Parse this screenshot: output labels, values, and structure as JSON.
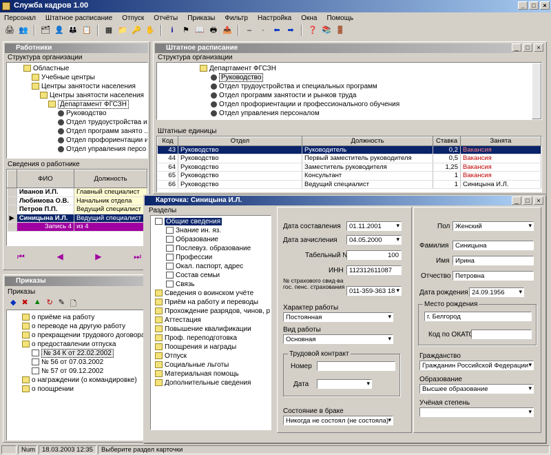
{
  "app": {
    "title": "Служба кадров 1.00"
  },
  "menu": [
    "Персонал",
    "Штатное расписание",
    "Отпуск",
    "Отчёты",
    "Приказы",
    "Фильтр",
    "Настройка",
    "Окна",
    "Помощь"
  ],
  "workers_panel": {
    "title": "Работники",
    "tree_label": "Структура организации",
    "tree": [
      "Областные",
      "Учебные центры",
      "Центры занятости населения",
      "Департамент ФГСЗН",
      "Руководство",
      "Отдел трудоустройства и ...",
      "Отдел программ занято ...",
      "Отдел профориентации и ...",
      "Отдел управления персо ..."
    ],
    "info_label": "Сведения о работнике",
    "columns": [
      "ФИО",
      "Должность"
    ],
    "rows": [
      {
        "fio": "Иванов И.П.",
        "pos": "Главный специалист"
      },
      {
        "fio": "Любимова О.В.",
        "pos": "Начальник отдела"
      },
      {
        "fio": "Петров П.П.",
        "pos": "Ведущий специалист"
      },
      {
        "fio": "Синицына И.Л.",
        "pos": "Ведущий специалист"
      }
    ],
    "record_label": "Запись 4",
    "record_of": "из 4"
  },
  "orders_panel": {
    "title": "Приказы",
    "label": "Приказы",
    "tree": [
      "о приёме на работу",
      "о переводе на другую работу",
      "о прекращении трудового договора",
      "о предоставлении отпуска",
      "№ 34 К от 22.02.2002",
      "№ 56 от 07.03.2002",
      "№ 57 от 09.12.2002",
      "о награждении (о командировке)",
      "о поощрении"
    ]
  },
  "staff_panel": {
    "title": "Штатное расписание",
    "tree_label": "Структура организации",
    "tree": [
      "Департамент ФГСЗН",
      "Руководство",
      "Отдел трудоустройства и специальных программ",
      "Отдел программ занятости и рынков труда",
      "Отдел профориентации и профессионального обучения",
      "Отдел управления персоналом"
    ],
    "units_label": "Штатные единицы",
    "columns": [
      "Код",
      "Отдел",
      "Должность",
      "Ставка",
      "Занята"
    ],
    "rows": [
      {
        "code": "43",
        "dept": "Руководство",
        "pos": "Руководитель",
        "rate": "0,2",
        "busy": "Вакансия"
      },
      {
        "code": "44",
        "dept": "Руководство",
        "pos": "Первый заместитель руководителя",
        "rate": "0,5",
        "busy": "Вакансия"
      },
      {
        "code": "64",
        "dept": "Руководство",
        "pos": "Заместитель руководителя",
        "rate": "1,25",
        "busy": "Вакансия"
      },
      {
        "code": "65",
        "dept": "Руководство",
        "pos": "Консультант",
        "rate": "1",
        "busy": "Вакансия"
      },
      {
        "code": "66",
        "dept": "Руководство",
        "pos": "Ведущий специалист",
        "rate": "1",
        "busy": "Синицына И.Л."
      }
    ]
  },
  "card": {
    "title": "Карточка: Синицына И.Л.",
    "sections_label": "Разделы",
    "sections": [
      "Общие сведения",
      "Знание ин. яз.",
      "Образование",
      "Послевуз. образование",
      "Профессии",
      "Окал. паспорт, адрес",
      "Состав семьи",
      "Связь",
      "Сведения о воинском учёте",
      "Приём на работу и переводы",
      "Прохождение разрядов, чинов, р...",
      "Аттестация",
      "Повышение квалификации",
      "Проф. переподготовка",
      "Поощрения и награды",
      "Отпуск",
      "Социальные льготы",
      "Материальная помощь",
      "Дополнительные сведения"
    ],
    "form": {
      "date_made_label": "Дата составления",
      "date_made": "01.11.2001",
      "date_hired_label": "Дата зачисления",
      "date_hired": "04.05.2000",
      "tab_label": "Табельный №",
      "tab": "100",
      "inn_label": "ИНН",
      "inn": "112312611087",
      "snils_label": "№ страхового свид-ва гос. пенс. страхования",
      "snils": "011-359-363 18",
      "work_type_label": "Характер работы",
      "work_type": "Постоянная",
      "kind_label": "Вид работы",
      "kind": "Основная",
      "contract_label": "Трудовой контракт",
      "num_label": "Номер",
      "date_label": "Дата",
      "marital_label": "Состояние в браке",
      "marital": "Никогда не состоял (не состояла)",
      "sex_label": "Пол",
      "sex": "Женский",
      "surname_label": "Фамилия",
      "surname": "Синицына",
      "name_label": "Имя",
      "name": "Ирина",
      "patr_label": "Отчество",
      "patr": "Петровна",
      "birth_label": "Дата рождения",
      "birth": "24.09.1956",
      "birthplace_label": "Место рождения",
      "birthplace": "г. Белгород",
      "okato_label": "Код по ОКАТО",
      "citizen_label": "Гражданство",
      "citizen": "Гражданин Российской Федерации",
      "edu_label": "Образование",
      "edu": "Высшее образование",
      "degree_label": "Учёная степень"
    }
  },
  "status": {
    "num": "Num",
    "date": "18.03.2003 12:35",
    "hint": "Выберите раздел карточки"
  }
}
